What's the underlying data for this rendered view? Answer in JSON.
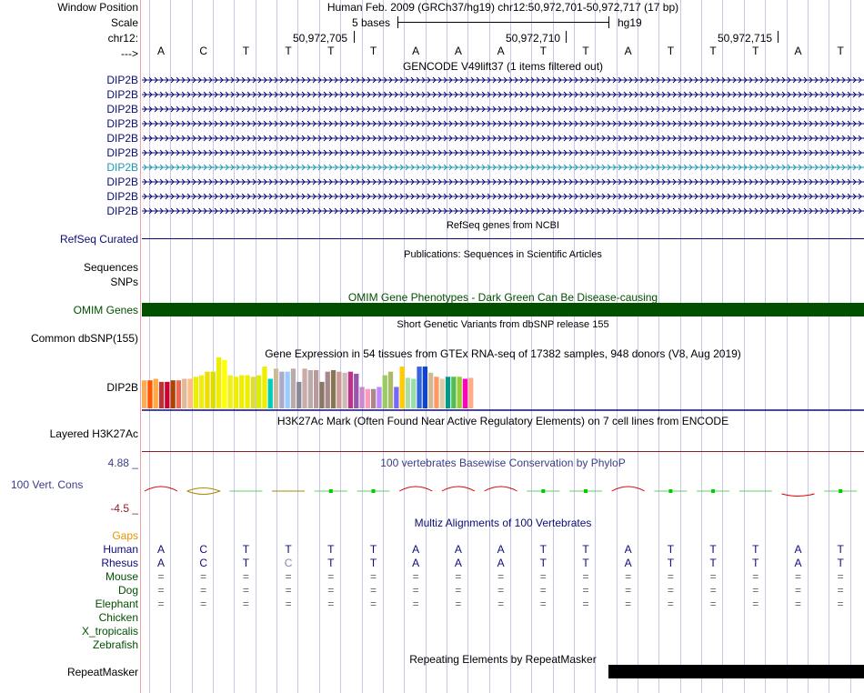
{
  "header": {
    "window_position_label": "Window Position",
    "window_position_value": "Human Feb. 2009 (GRCh37/hg19)   chr12:50,972,701-50,972,717 (17 bp)",
    "scale_label": "Scale",
    "scale_value": "5 bases",
    "scale_db": "hg19",
    "chrom_label": "chr12:",
    "positions": [
      "50,972,705",
      "50,972,710",
      "50,972,715"
    ],
    "arrow_label": "--->",
    "bases": [
      "A",
      "C",
      "T",
      "T",
      "T",
      "T",
      "A",
      "A",
      "A",
      "T",
      "T",
      "A",
      "T",
      "T",
      "T",
      "A",
      "T"
    ]
  },
  "gencode": {
    "title": "GENCODE V49lift37 (1 items filtered out)",
    "items": [
      "DIP2B",
      "DIP2B",
      "DIP2B",
      "DIP2B",
      "DIP2B",
      "DIP2B",
      "DIP2B",
      "DIP2B",
      "DIP2B",
      "DIP2B"
    ],
    "highlight_index": 6,
    "colors": {
      "default": "#0c0c78",
      "highlight": "#1e96b4"
    }
  },
  "refseq": {
    "title": "RefSeq genes from NCBI",
    "label": "RefSeq Curated"
  },
  "publications": {
    "title": "Publications: Sequences in Scientific Articles",
    "label1": "Sequences",
    "label2": "SNPs"
  },
  "omim": {
    "title": "OMIM Gene Phenotypes - Dark Green Can Be Disease-causing",
    "label": "OMIM Genes",
    "color": "#005000"
  },
  "dbsnp": {
    "title": "Short Genetic Variants from dbSNP release 155",
    "label": "Common dbSNP(155)"
  },
  "gtex": {
    "title": "Gene Expression in 54 tissues from GTEx RNA-seq of 17382 samples, 948 donors (V8, Aug 2019)",
    "label": "DIP2B",
    "bar_values": [
      0.55,
      0.55,
      0.58,
      0.52,
      0.52,
      0.55,
      0.55,
      0.58,
      0.58,
      0.62,
      0.65,
      0.72,
      0.72,
      1.0,
      0.95,
      0.65,
      0.62,
      0.65,
      0.65,
      0.62,
      0.65,
      0.82,
      0.58,
      0.78,
      0.72,
      0.72,
      0.78,
      0.52,
      0.78,
      0.75,
      0.75,
      0.52,
      0.72,
      0.75,
      0.72,
      0.7,
      0.72,
      0.68,
      0.42,
      0.38,
      0.38,
      0.42,
      0.65,
      0.72,
      0.42,
      0.82,
      0.6,
      0.58,
      0.82,
      0.82,
      0.7,
      0.62,
      0.58,
      0.62,
      0.62,
      0.62,
      0.58,
      0.6
    ],
    "bar_colors": [
      "#ffaa55",
      "#ff5500",
      "#ffaa44",
      "#bb3333",
      "#cc0033",
      "#aa4400",
      "#ee6655",
      "#ddbb99",
      "#ffbb88",
      "#eeee00",
      "#eeee11",
      "#eedd00",
      "#dddd00",
      "#eeee00",
      "#ffff00",
      "#eeee22",
      "#eeee00",
      "#eeee00",
      "#eeee00",
      "#dddd33",
      "#ddee00",
      "#eeee00",
      "#00ccbb",
      "#ccbb99",
      "#aaaacc",
      "#99ccff",
      "#bbaaaa",
      "#888899",
      "#ccaaaa",
      "#bbaaaa",
      "#bb9999",
      "#887766",
      "#aa8888",
      "#887755",
      "#cc9999",
      "#ccbbbb",
      "#bb3388",
      "#9955aa",
      "#cc88cc",
      "#ff99bb",
      "#aa8888",
      "#bb88ff",
      "#99cc66",
      "#aabb66",
      "#7766ff",
      "#ffcc00",
      "#aaddaa",
      "#99ddaa",
      "#3366dd",
      "#1144cc",
      "#ccbb99",
      "#ff9966",
      "#ddccaa",
      "#009988",
      "#55bb55",
      "#99cc33",
      "#ff00bb",
      "#ffaa88"
    ]
  },
  "h3k27ac": {
    "title": "H3K27Ac Mark (Often Found Near Active Regulatory Elements) on 7 cell lines from ENCODE",
    "label": "Layered H3K27Ac"
  },
  "conservation": {
    "title": "100 vertebrates Basewise Conservation by PhyloP",
    "label": "100 Vert. Cons",
    "max_label": "4.88 _",
    "min_label": "-4.5 _",
    "phylop_scores": [
      1.2,
      -1.0,
      0,
      -0.3,
      0.5,
      0.5,
      1.0,
      1.0,
      1.0,
      0.5,
      0.5,
      1.0,
      0.5,
      0.5,
      0,
      -0.6,
      0.5
    ]
  },
  "multiz": {
    "title": "Multiz Alignments of 100 Vertebrates",
    "gaps_label": "Gaps",
    "species": [
      {
        "name": "Human",
        "seq": [
          "A",
          "C",
          "T",
          "T",
          "T",
          "T",
          "A",
          "A",
          "A",
          "T",
          "T",
          "A",
          "T",
          "T",
          "T",
          "A",
          "T"
        ]
      },
      {
        "name": "Rhesus",
        "seq": [
          "A",
          "C",
          "T",
          "C",
          "T",
          "T",
          "A",
          "A",
          "A",
          "T",
          "T",
          "A",
          "T",
          "T",
          "T",
          "A",
          "T"
        ]
      },
      {
        "name": "Mouse",
        "seq": [
          "=",
          "=",
          "=",
          "=",
          "=",
          "=",
          "=",
          "=",
          "=",
          "=",
          "=",
          "=",
          "=",
          "=",
          "=",
          "=",
          "="
        ]
      },
      {
        "name": "Dog",
        "seq": [
          "=",
          "=",
          "=",
          "=",
          "=",
          "=",
          "=",
          "=",
          "=",
          "=",
          "=",
          "=",
          "=",
          "=",
          "=",
          "=",
          "="
        ]
      },
      {
        "name": "Elephant",
        "seq": [
          "=",
          "=",
          "=",
          "=",
          "=",
          "=",
          "=",
          "=",
          "=",
          "=",
          "=",
          "=",
          "=",
          "=",
          "=",
          "=",
          "="
        ]
      },
      {
        "name": "Chicken",
        "seq": []
      },
      {
        "name": "X_tropicalis",
        "seq": []
      },
      {
        "name": "Zebrafish",
        "seq": []
      }
    ]
  },
  "repeatmasker": {
    "title": "Repeating Elements by RepeatMasker",
    "label": "RepeatMasker"
  }
}
